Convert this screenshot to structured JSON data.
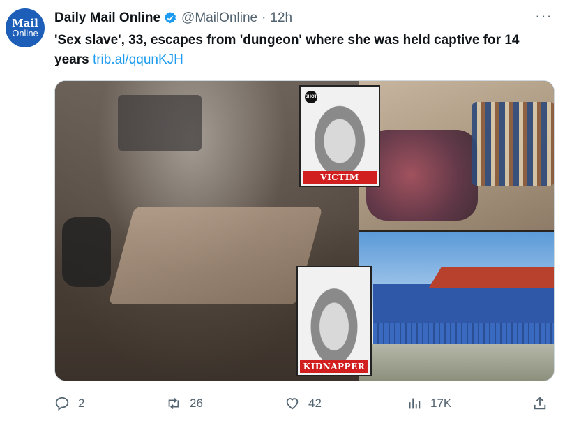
{
  "account": {
    "avatar_line1": "Mail",
    "avatar_line2": "Online",
    "name": "Daily Mail Online",
    "handle": "@MailOnline",
    "separator": "·",
    "time": "12h",
    "more": "···"
  },
  "tweet": {
    "text": "'Sex slave', 33, escapes from 'dungeon' where she was held captive for 14 years",
    "link": "trib.al/qqunKJH"
  },
  "media": {
    "victim_label": "VICTIM",
    "kidnapper_label": "KIDNAPPER",
    "shot_logo": "SHOT"
  },
  "actions": {
    "replies": "2",
    "retweets": "26",
    "likes": "42",
    "views": "17K"
  },
  "colors": {
    "accent": "#1d9bf0",
    "secondary_text": "#536471",
    "label_red": "#d11f1f",
    "avatar_blue": "#1d5fb8"
  }
}
